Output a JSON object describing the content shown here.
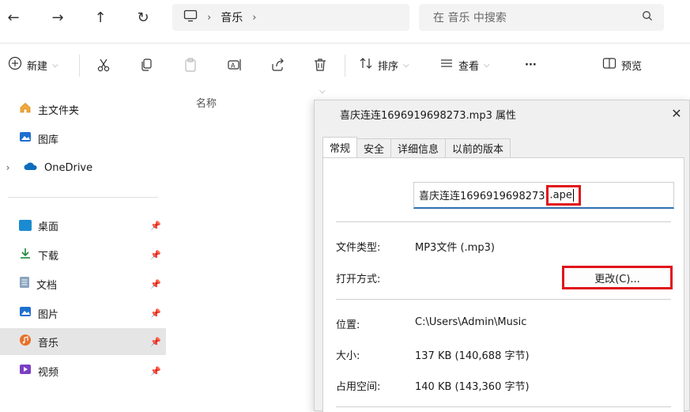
{
  "nav": {
    "back": "←",
    "forward": "→",
    "up": "↑",
    "refresh": "↻"
  },
  "address": {
    "segment": "音乐",
    "chevron": "›"
  },
  "search": {
    "placeholder": "在 音乐 中搜索"
  },
  "toolbar": {
    "new_label": "新建",
    "sort_label": "排序",
    "view_label": "查看",
    "more_label": "···",
    "preview_label": "预览"
  },
  "sidebar": {
    "items": [
      {
        "label": "主文件夹",
        "icon": "home-icon"
      },
      {
        "label": "图库",
        "icon": "gallery-icon"
      },
      {
        "label": "OneDrive",
        "icon": "onedrive-icon"
      },
      {
        "label": "桌面",
        "icon": "desktop-icon"
      },
      {
        "label": "下载",
        "icon": "download-icon"
      },
      {
        "label": "文档",
        "icon": "document-icon"
      },
      {
        "label": "图片",
        "icon": "pictures-icon"
      },
      {
        "label": "音乐",
        "icon": "music-icon"
      },
      {
        "label": "视频",
        "icon": "video-icon"
      }
    ]
  },
  "content": {
    "column_name": "名称"
  },
  "dialog": {
    "title": "喜庆连连1696919698273.mp3 属性",
    "close": "✕",
    "tabs": [
      "常规",
      "安全",
      "详细信息",
      "以前的版本"
    ],
    "filename_base": "喜庆连连1696919698273",
    "filename_ext": ".ape",
    "file_type_label": "文件类型:",
    "file_type_value": "MP3文件 (.mp3)",
    "open_with_label": "打开方式:",
    "change_button": "更改(C)...",
    "location_label": "位置:",
    "location_value": "C:\\Users\\Admin\\Music",
    "size_label": "大小:",
    "size_value": "137 KB (140,688 字节)",
    "disk_size_label": "占用空间:",
    "disk_size_value": "140 KB (143,360 字节)"
  },
  "colors": {
    "highlight": "#e0141b",
    "accent": "#2f6fb0",
    "active_item": "#e5e5e5"
  }
}
